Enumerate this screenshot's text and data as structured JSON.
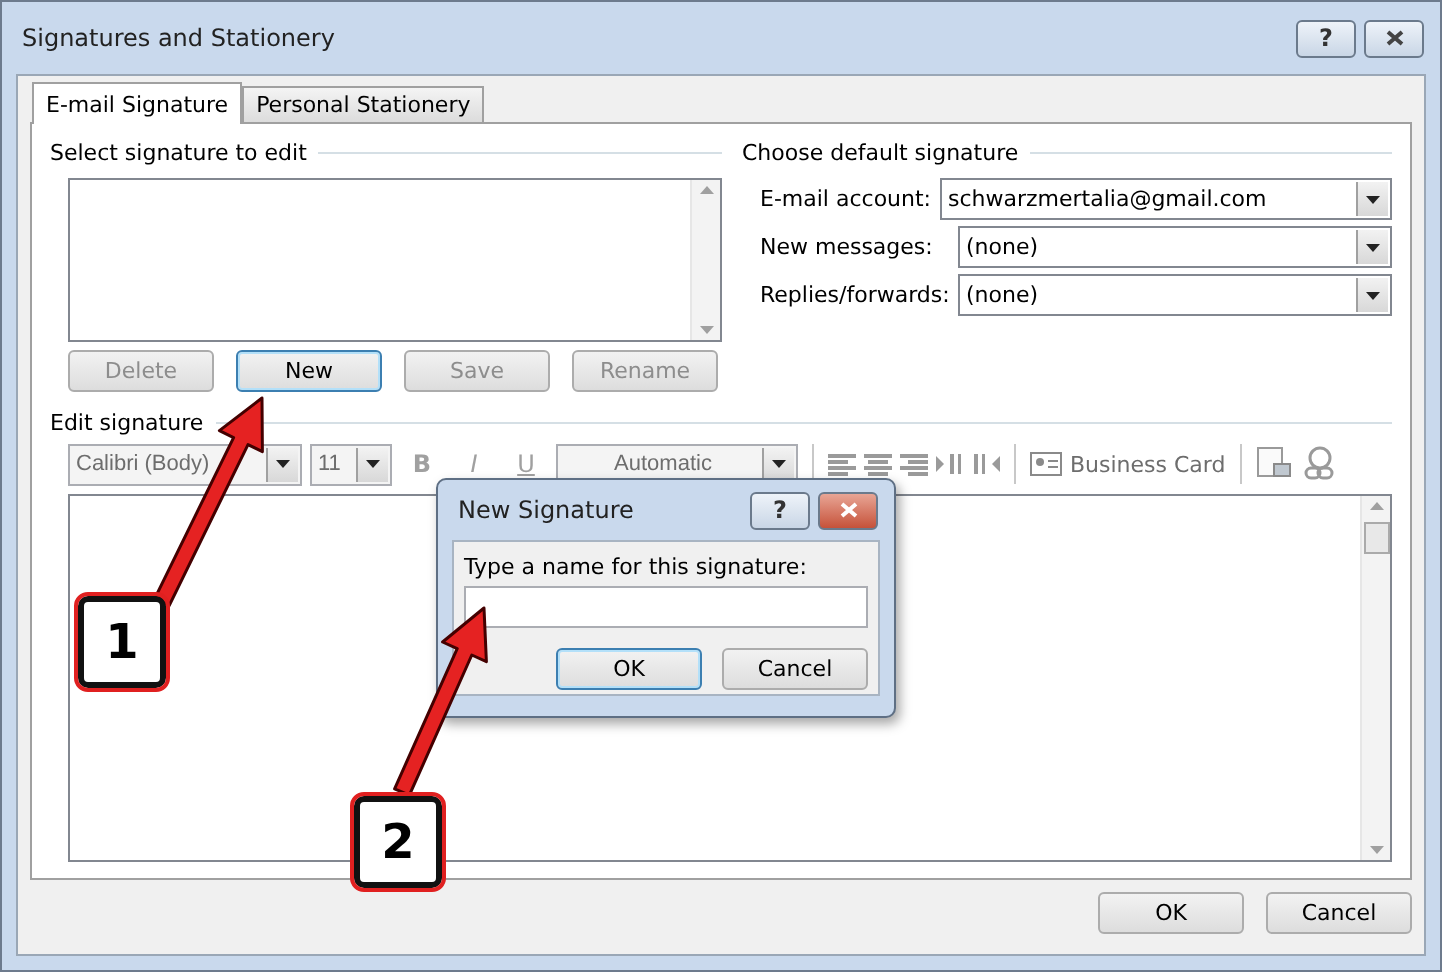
{
  "window": {
    "title": "Signatures and Stationery",
    "help": "?"
  },
  "tabs": [
    {
      "label": "E-mail Signature",
      "selected": true
    },
    {
      "label": "Personal Stationery",
      "selected": false
    }
  ],
  "select_signature": {
    "label": "Select signature to edit",
    "buttons": [
      {
        "label": "Delete",
        "disabled": true,
        "focused": false
      },
      {
        "label": "New",
        "disabled": false,
        "focused": true
      },
      {
        "label": "Save",
        "disabled": true,
        "focused": false
      },
      {
        "label": "Rename",
        "disabled": true,
        "focused": false
      }
    ]
  },
  "default_signature": {
    "label": "Choose default signature",
    "fields": [
      {
        "label": "E-mail account:",
        "value": "schwarzmertalia@gmail.com"
      },
      {
        "label": "New messages:",
        "value": "(none)"
      },
      {
        "label": "Replies/forwards:",
        "value": "(none)"
      }
    ]
  },
  "edit_signature": {
    "label": "Edit signature",
    "font": "Calibri (Body)",
    "size": "11",
    "format": [
      "B",
      "I",
      "U"
    ],
    "color_label": "Automatic",
    "business_card": "Business Card"
  },
  "footer_buttons": [
    {
      "label": "OK"
    },
    {
      "label": "Cancel"
    }
  ],
  "new_signature_dialog": {
    "title": "New Signature",
    "help": "?",
    "prompt": "Type a name for this signature:",
    "buttons": [
      {
        "label": "OK",
        "focused": true
      },
      {
        "label": "Cancel",
        "focused": false
      }
    ]
  },
  "callouts": [
    {
      "number": "1"
    },
    {
      "number": "2"
    }
  ]
}
